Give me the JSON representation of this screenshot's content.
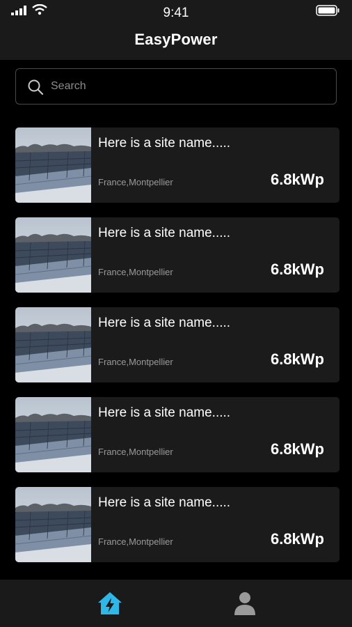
{
  "status": {
    "time": "9:41"
  },
  "header": {
    "title": "EasyPower"
  },
  "search": {
    "placeholder": "Search"
  },
  "sites": [
    {
      "name": "Here is a site name.....",
      "location": "France,Montpellier",
      "power": "6.8kWp"
    },
    {
      "name": "Here is a site name.....",
      "location": "France,Montpellier",
      "power": "6.8kWp"
    },
    {
      "name": "Here is a site name.....",
      "location": "France,Montpellier",
      "power": "6.8kWp"
    },
    {
      "name": "Here is a site name.....",
      "location": "France,Montpellier",
      "power": "6.8kWp"
    },
    {
      "name": "Here is a site name.....",
      "location": "France,Montpellier",
      "power": "6.8kWp"
    }
  ],
  "tabbar": {
    "items": [
      {
        "icon": "home-power-icon",
        "active": true
      },
      {
        "icon": "user-icon",
        "active": false
      }
    ]
  },
  "colors": {
    "accent": "#2fb7e8",
    "background": "#000000",
    "card": "#1b1b1b",
    "bar": "#1a1a1a"
  }
}
